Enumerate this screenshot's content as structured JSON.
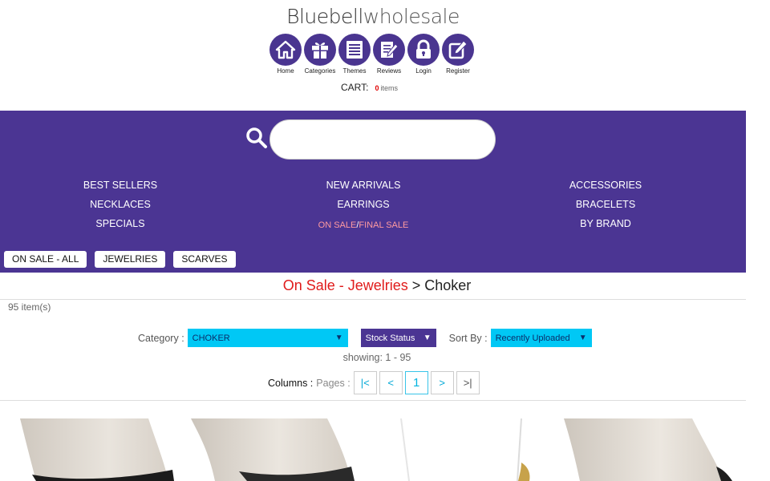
{
  "header": {
    "logo_part1": "Bluebell",
    "logo_part2": "wholesale",
    "nav": [
      {
        "label": "Home",
        "icon": "home-icon"
      },
      {
        "label": "Categories",
        "icon": "gift-icon"
      },
      {
        "label": "Themes",
        "icon": "list-icon"
      },
      {
        "label": "Reviews",
        "icon": "edit-document-icon"
      },
      {
        "label": "Login",
        "icon": "lock-icon"
      },
      {
        "label": "Register",
        "icon": "pencil-square-icon"
      }
    ],
    "cart_label": "CART:",
    "cart_count": "0",
    "cart_items": "items"
  },
  "colors": {
    "purple": "#4b3593",
    "cyan": "#00c8f5",
    "sale_red": "#e01b1b",
    "sale_pink": "#ff9aa0"
  },
  "search": {
    "placeholder": ""
  },
  "menu": {
    "col1": [
      "BEST SELLERS",
      "NECKLACES",
      "SPECIALS"
    ],
    "col2": [
      "NEW ARRIVALS",
      "EARRINGS"
    ],
    "on_sale": "ON SALE",
    "slash": "/",
    "final_sale": "FINAL SALE",
    "col3": [
      "ACCESSORIES",
      "BRACELETS",
      "BY BRAND"
    ]
  },
  "tags": [
    "ON SALE - ALL",
    "JEWELRIES",
    "SCARVES"
  ],
  "breadcrumb": {
    "part1": "On Sale - Jewelries",
    "sep": " > ",
    "current": "Choker"
  },
  "item_count": "95 item(s)",
  "filters": {
    "category_label": "Category :",
    "category_value": "CHOKER",
    "stock_value": "Stock Status",
    "sort_label": "Sort By :",
    "sort_value": "Recently Uploaded"
  },
  "showing": "showing: 1 - 95",
  "pager": {
    "columns_label": "Columns :",
    "pages_label": "Pages :",
    "first": "|<",
    "prev": "<",
    "current": "1",
    "next": ">",
    "last": ">|"
  }
}
